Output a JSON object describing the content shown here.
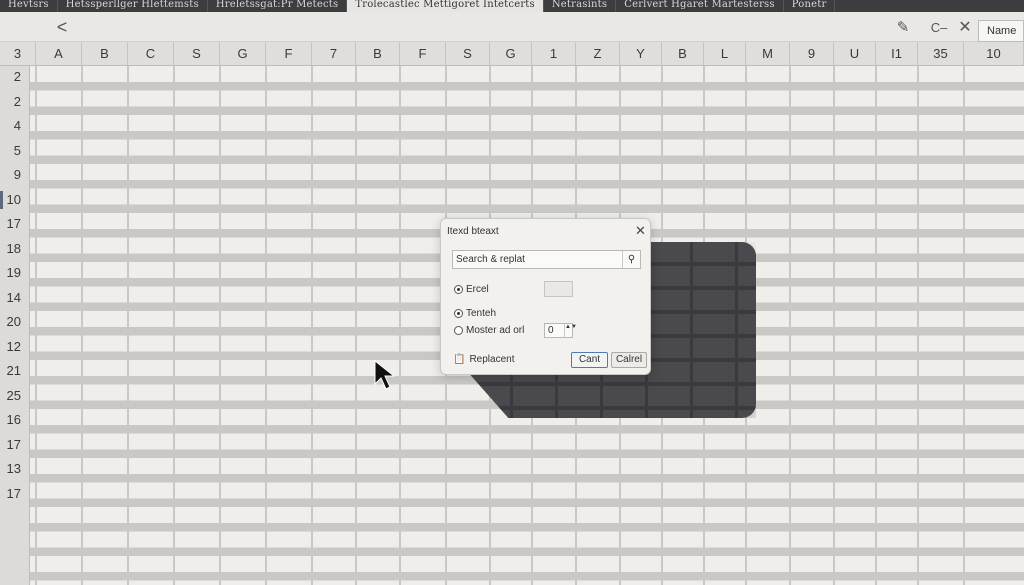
{
  "tabs": [
    {
      "label": "Hevtsrs"
    },
    {
      "label": "Hetssperllger Hlettemsts"
    },
    {
      "label": "Hreletssgat:Pr Metects"
    },
    {
      "label": "Trolecastlec Mettigoret Intetcerts"
    },
    {
      "label": "Netrasints"
    },
    {
      "label": "Cerlvert Hgaret Martesterss"
    },
    {
      "label": "Ponetr"
    }
  ],
  "toolbar": {
    "back_glyph": "<",
    "edit_glyph": "✎",
    "undo_glyph": "C–",
    "close_glyph": "✕",
    "name_box": "Name"
  },
  "column_headers": [
    "3",
    "A",
    "B",
    "C",
    "S",
    "G",
    "F",
    "7",
    "B",
    "F",
    "S",
    "G",
    "1",
    "Z",
    "Y",
    "B",
    "L",
    "M",
    "9",
    "U",
    "I1",
    "35",
    "10"
  ],
  "row_headers": [
    "2",
    "2",
    "4",
    "5",
    "9",
    "10",
    "17",
    "18",
    "19",
    "14",
    "20",
    "12",
    "21",
    "25",
    "16",
    "17",
    "13",
    "17"
  ],
  "active_row_index": 5,
  "dialog": {
    "title": "Itexd bteaxt",
    "close_glyph": "✕",
    "search_value": "Search & replat",
    "search_icon": "⚲",
    "option_excel": "Ercel",
    "option_tenteh": "Tenteh",
    "option_master": "Moster ad orl",
    "stepper_value": "0",
    "stepper_arrows": "▲▼",
    "replacement_icon": "📋",
    "replacement_label": "Replacent",
    "btn_primary": "Cant",
    "btn_secondary": "Calrel"
  },
  "colors": {
    "grid_bg": "#efeeea",
    "grid_line": "#c9c8c4",
    "selection": "#4a494d",
    "tabbar": "#3d3d3f"
  }
}
